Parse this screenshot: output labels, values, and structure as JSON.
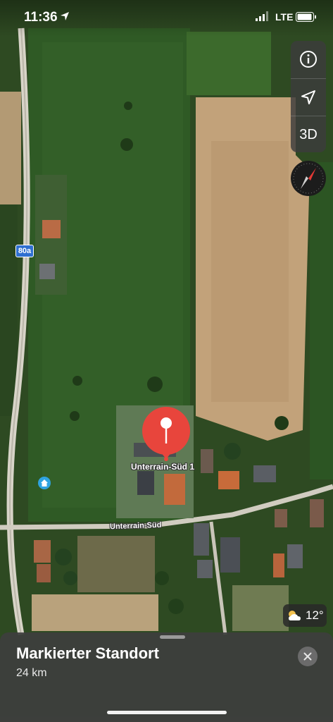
{
  "status": {
    "time": "11:36",
    "network": "LTE"
  },
  "map": {
    "road_badge": "80a",
    "street_name": "Unterrain-Süd",
    "place_name": "Unterrain-Süd 1",
    "controls": {
      "threed_label": "3D"
    },
    "weather": {
      "temperature": "12°",
      "icon": "partly-cloudy-icon"
    },
    "pin_color": "#e8453c"
  },
  "sheet": {
    "title": "Markierter Standort",
    "distance": "24 km"
  }
}
